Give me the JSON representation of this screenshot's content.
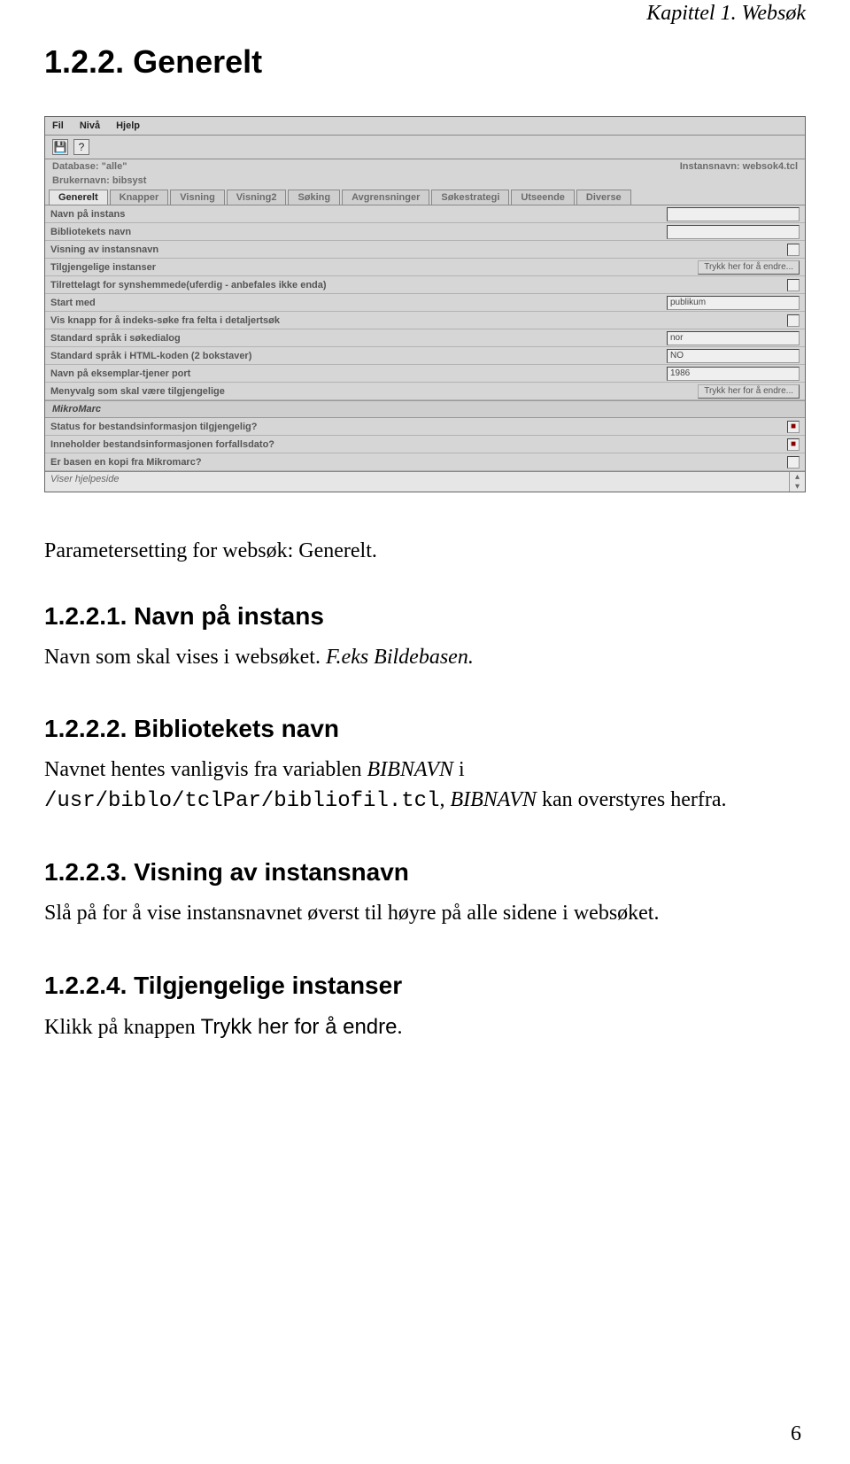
{
  "header": {
    "chapter": "Kapittel 1. Websøk",
    "title": "1.2.2. Generelt"
  },
  "screenshot": {
    "menu": [
      "Fil",
      "Nivå",
      "Hjelp"
    ],
    "info": {
      "database": "Database: \"alle\"",
      "brukernavn": "Brukernavn: bibsyst",
      "instans": "Instansnavn: websok4.tcl"
    },
    "tabs": [
      "Generelt",
      "Knapper",
      "Visning",
      "Visning2",
      "Søking",
      "Avgrensninger",
      "Søkestrategi",
      "Utseende",
      "Diverse"
    ],
    "rows": [
      {
        "label": "Navn på instans"
      },
      {
        "label": "Bibliotekets navn"
      },
      {
        "label": "Visning av instansnavn",
        "check": ""
      },
      {
        "label": "Tilgjengelige instanser",
        "button": "Trykk her for å endre..."
      },
      {
        "label": "Tilrettelagt for synshemmede(uferdig - anbefales ikke enda)",
        "check": ""
      },
      {
        "label": "Start med",
        "value": "publikum"
      },
      {
        "label": "Vis knapp for å indeks-søke fra felta i detaljertsøk",
        "check": ""
      },
      {
        "label": "Standard språk i søkedialog",
        "value": "nor"
      },
      {
        "label": "Standard språk i HTML-koden (2 bokstaver)",
        "value": "NO"
      },
      {
        "label": "Navn på eksemplar-tjener port",
        "value": "1986"
      },
      {
        "label": "Menyvalg som skal være tilgjengelige",
        "button": "Trykk her for å endre..."
      }
    ],
    "section_head": "MikroMarc",
    "rows2": [
      {
        "label": "Status for bestandsinformasjon tilgjengelig?",
        "check": "■"
      },
      {
        "label": "Inneholder bestandsinformasjonen forfallsdato?",
        "check": "■"
      },
      {
        "label": "Er basen en kopi fra Mikromarc?",
        "check": ""
      }
    ],
    "status": "Viser hjelpeside"
  },
  "para1": "Parametersetting for websøk: Generelt.",
  "s1": {
    "heading": "1.2.2.1. Navn på instans",
    "line1a": "Navn som skal vises i websøket. ",
    "line1b": "F.eks Bildebasen."
  },
  "s2": {
    "heading": "1.2.2.2. Bibliotekets navn",
    "line1a": "Navnet hentes vanligvis fra variablen ",
    "var1": "BIBNAVN",
    "line1b": " i",
    "path": "/usr/biblo/tclPar/bibliofil.tcl",
    "line2a": ", ",
    "var2": "BIBNAVN",
    "line2b": " kan overstyres herfra."
  },
  "s3": {
    "heading": "1.2.2.3. Visning av instansnavn",
    "line1": "Slå på for å vise instansnavnet øverst til høyre på alle sidene i websøket."
  },
  "s4": {
    "heading": "1.2.2.4. Tilgjengelige instanser",
    "line1a": "Klikk på knappen ",
    "btn": "Trykk her for å endre",
    "line1b": "."
  },
  "pagenum": "6"
}
